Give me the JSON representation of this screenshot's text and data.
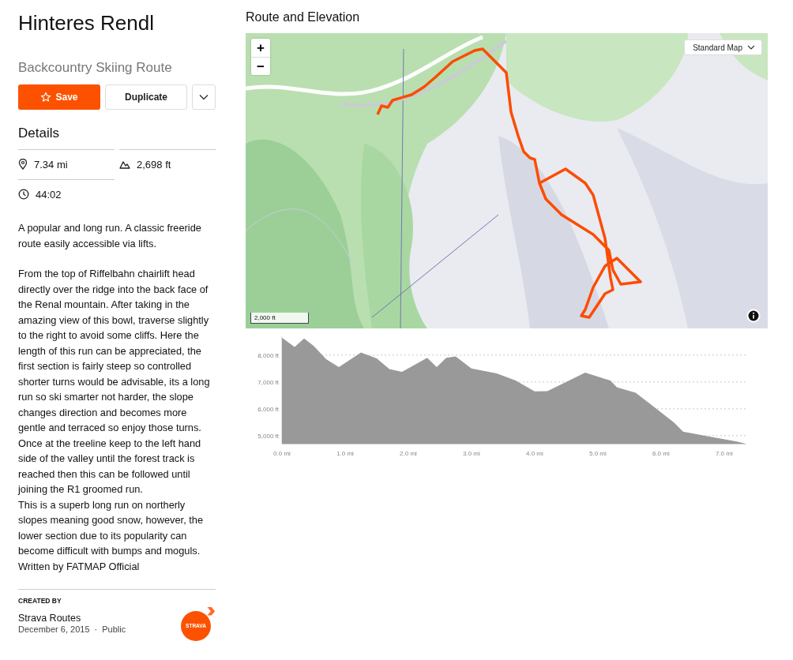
{
  "route": {
    "title": "Hinteres Rendl",
    "type": "Backcountry Skiing Route"
  },
  "actions": {
    "save": "Save",
    "duplicate": "Duplicate"
  },
  "details": {
    "heading": "Details",
    "stats": [
      {
        "kind": "distance",
        "value": "7.34 mi"
      },
      {
        "kind": "elevation",
        "value": "2,698 ft"
      },
      {
        "kind": "time",
        "value": "44:02"
      }
    ]
  },
  "description": [
    "A popular and long run. A classic  freeride route easily accessible via lifts.",
    "From the top of Riffelbahn chairlift head directly over the ridge into the back face of the Renal mountain. After taking in the amazing view of this bowl, traverse slightly to the right to avoid some cliffs. Here the length of this run can be appreciated, the first section is fairly steep so controlled shorter turns would be advisable, its a long run so ski smarter not harder, the slope changes direction and becomes more gentle and terraced so enjoy those turns.\nOnce at the treeline keep to the left hand side of the valley until the forest track is reached then this can be followed until joining the R1 groomed run.\nThis is a superb long run on northerly slopes meaning good snow, however, the lower section due to its popularity can become difficult with bumps and moguls.  Written by FATMAP Official"
  ],
  "creator": {
    "label": "CREATED BY",
    "name": "Strava Routes",
    "date": "December 6, 2015",
    "separator": "·",
    "visibility": "Public",
    "logo": "STRAVA"
  },
  "map_section": {
    "heading": "Route and Elevation",
    "map": {
      "kind": "picture",
      "zoom_in": "+",
      "zoom_out": "−",
      "style": "Standard Map",
      "scale": "2,000 ft"
    },
    "chart_data": {
      "type": "area",
      "x": [
        0,
        0.2,
        0.35,
        0.5,
        0.7,
        0.9,
        1.25,
        1.5,
        1.7,
        1.9,
        2.3,
        2.45,
        2.6,
        2.75,
        3.0,
        3.4,
        3.7,
        4.0,
        4.2,
        4.8,
        5.2,
        5.3,
        5.6,
        5.9,
        6.2,
        6.35,
        6.8,
        7.2,
        7.34
      ],
      "series": [
        {
          "color": "#999999",
          "values": [
            8650,
            8300,
            8620,
            8350,
            7850,
            7550,
            8100,
            7880,
            7480,
            7380,
            7900,
            7550,
            7900,
            7950,
            7500,
            7320,
            7050,
            6650,
            6660,
            7350,
            7050,
            6800,
            6600,
            6050,
            5500,
            5150,
            4950,
            4780,
            4700
          ]
        }
      ],
      "xlim": [
        0,
        7.34
      ],
      "ylim": [
        4700,
        8700
      ],
      "grid": true,
      "xticks": [
        {
          "value": 0,
          "label": "0.0 mi"
        },
        {
          "value": 1,
          "label": "1.0 mi"
        },
        {
          "value": 2,
          "label": "2.0 mi"
        },
        {
          "value": 3,
          "label": "3.0 mi"
        },
        {
          "value": 4,
          "label": "4.0 mi"
        },
        {
          "value": 5,
          "label": "5.0 mi"
        },
        {
          "value": 6,
          "label": "6.0 mi"
        },
        {
          "value": 7,
          "label": "7.0 mi"
        }
      ],
      "yticks": [
        {
          "value": 5000,
          "label": "5,000 ft"
        },
        {
          "value": 6000,
          "label": "6,000 ft"
        },
        {
          "value": 7000,
          "label": "7,000 ft"
        },
        {
          "value": 8000,
          "label": "8,000 ft"
        }
      ]
    }
  }
}
